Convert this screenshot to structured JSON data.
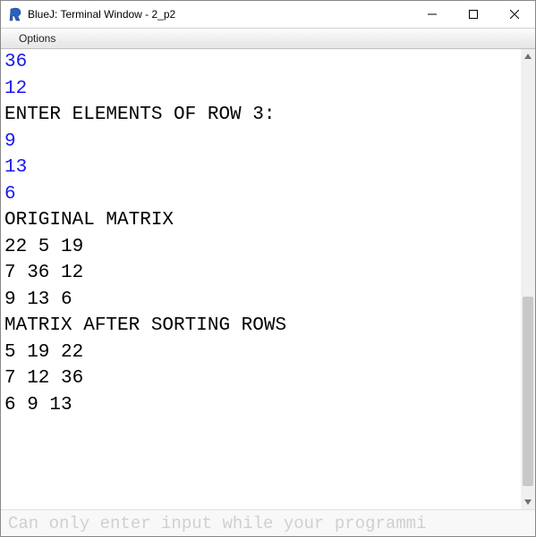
{
  "titlebar": {
    "title": "BlueJ: Terminal Window - 2_p2"
  },
  "menu": {
    "options": "Options"
  },
  "terminal": {
    "lines": [
      {
        "text": "36",
        "input": true
      },
      {
        "text": "12",
        "input": true
      },
      {
        "text": "ENTER ELEMENTS OF ROW 3:",
        "input": false
      },
      {
        "text": "9",
        "input": true
      },
      {
        "text": "13",
        "input": true
      },
      {
        "text": "6",
        "input": true
      },
      {
        "text": "ORIGINAL MATRIX",
        "input": false
      },
      {
        "text": "22 5 19",
        "input": false
      },
      {
        "text": "7 36 12",
        "input": false
      },
      {
        "text": "9 13 6",
        "input": false
      },
      {
        "text": "MATRIX AFTER SORTING ROWS",
        "input": false
      },
      {
        "text": "5 19 22",
        "input": false
      },
      {
        "text": "7 12 36",
        "input": false
      },
      {
        "text": "6 9 13",
        "input": false
      },
      {
        "text": "",
        "input": false
      },
      {
        "text": "",
        "input": false
      }
    ]
  },
  "bottom": {
    "placeholder": "Can only enter input while your programmi"
  }
}
